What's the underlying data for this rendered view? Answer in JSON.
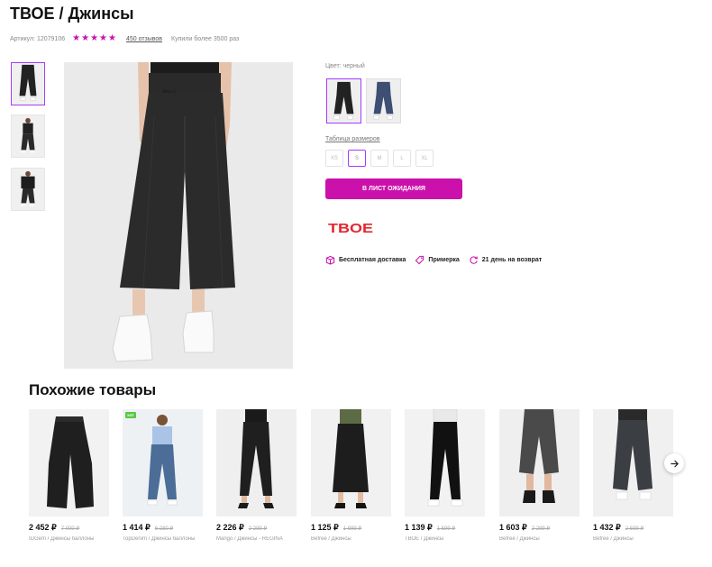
{
  "product": {
    "title": "ТВОЕ / Джинсы",
    "article": "Артикул: 12079106",
    "rating_stars": "★★★★★",
    "reviews": "450 отзывов",
    "bought": "Купили более 3500 раз"
  },
  "color": {
    "label": "Цвет: черный",
    "options": [
      {
        "name": "черный",
        "selected": true,
        "swatch": "#222222"
      },
      {
        "name": "синий",
        "selected": false,
        "swatch": "#3d4f72"
      }
    ]
  },
  "sizes": {
    "table_link": "Таблица размеров",
    "options": [
      {
        "label": "XS",
        "selected": false
      },
      {
        "label": "S",
        "selected": true
      },
      {
        "label": "M",
        "selected": false
      },
      {
        "label": "L",
        "selected": false
      },
      {
        "label": "XL",
        "selected": false
      }
    ]
  },
  "actions": {
    "wait_list": "В ЛИСТ ОЖИДАНИЯ"
  },
  "brand": {
    "logo_text": "TBOE",
    "color": "#e3262e"
  },
  "perks": [
    {
      "icon": "box-icon",
      "label": "Бесплатная доставка"
    },
    {
      "icon": "tag-icon",
      "label": "Примерка"
    },
    {
      "icon": "return-icon",
      "label": "21 день на возврат"
    }
  ],
  "similar": {
    "title": "Похожие товары",
    "items": [
      {
        "price": "2 452 ₽",
        "old_price": "7 000 ₽",
        "name": "IDGem / Джинсы баллоны",
        "badge": ""
      },
      {
        "price": "1 414 ₽",
        "old_price": "6 280 ₽",
        "name": "TopDenim / Джинсы баллоны",
        "badge": "ХИТ"
      },
      {
        "price": "2 226 ₽",
        "old_price": "2 299 ₽",
        "name": "Mango / Джинсы - REGINA",
        "badge": ""
      },
      {
        "price": "1 125 ₽",
        "old_price": "1 999 ₽",
        "name": "Befree / Джинсы",
        "badge": ""
      },
      {
        "price": "1 139 ₽",
        "old_price": "1 599 ₽",
        "name": "ТВОЕ / Джинсы",
        "badge": ""
      },
      {
        "price": "1 603 ₽",
        "old_price": "2 299 ₽",
        "name": "Befree / Джинсы",
        "badge": ""
      },
      {
        "price": "1 432 ₽",
        "old_price": "2 599 ₽",
        "name": "Befree / Джинсы",
        "badge": ""
      }
    ]
  },
  "colors": {
    "accent": "#cb11ab",
    "selection": "#a73afd"
  }
}
